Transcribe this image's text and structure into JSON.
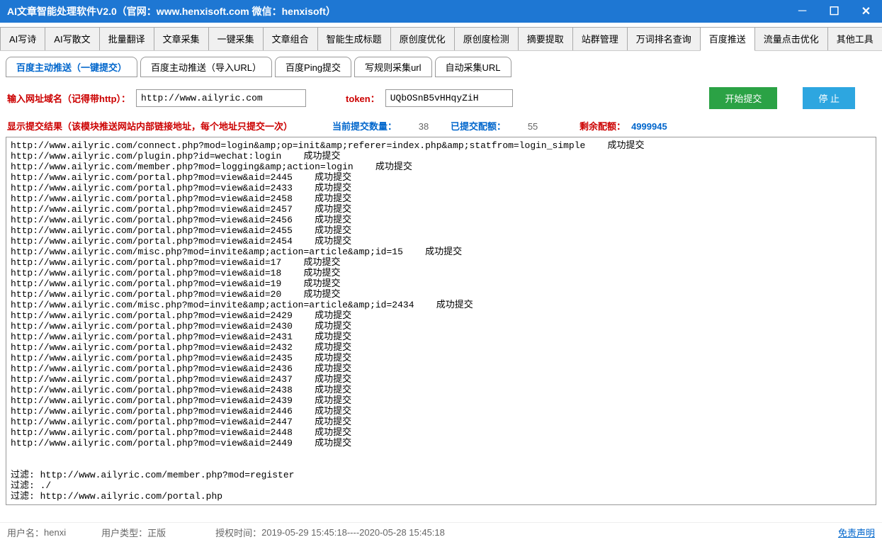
{
  "title": "AI文章智能处理软件V2.0（官网：www.henxisoft.com  微信：henxisoft）",
  "mainTabs": [
    "AI写诗",
    "AI写散文",
    "批量翻译",
    "文章采集",
    "一键采集",
    "文章组合",
    "智能生成标题",
    "原创度优化",
    "原创度检测",
    "摘要提取",
    "站群管理",
    "万词排名查询",
    "百度推送",
    "流量点击优化",
    "其他工具"
  ],
  "activeMainTab": 12,
  "subTabs": [
    "百度主动推送（一键提交）",
    "百度主动推送（导入URL）",
    "百度Ping提交",
    "写规则采集url",
    "自动采集URL"
  ],
  "activeSubTab": 0,
  "form": {
    "urlLabel": "输入网址域名（记得带http）：",
    "urlValue": "http://www.ailyric.com",
    "tokenLabel": "token：",
    "tokenValue": "UQbOSnB5vHHqyZiH",
    "startBtn": "开始提交",
    "stopBtn": "停  止"
  },
  "status": {
    "resultLabel": "显示提交结果（该模块推送网站内部链接地址，每个地址只提交一次）",
    "currentLabel": "当前提交数量：",
    "currentValue": "38",
    "submittedLabel": "已提交配额：",
    "submittedValue": "55",
    "remainLabel": "剩余配额：",
    "remainValue": "4999945"
  },
  "log": "http://www.ailyric.com/connect.php?mod=login&amp;op=init&amp;referer=index.php&amp;statfrom=login_simple    成功提交\nhttp://www.ailyric.com/plugin.php?id=wechat:login    成功提交\nhttp://www.ailyric.com/member.php?mod=logging&amp;action=login    成功提交\nhttp://www.ailyric.com/portal.php?mod=view&aid=2445    成功提交\nhttp://www.ailyric.com/portal.php?mod=view&aid=2433    成功提交\nhttp://www.ailyric.com/portal.php?mod=view&aid=2458    成功提交\nhttp://www.ailyric.com/portal.php?mod=view&aid=2457    成功提交\nhttp://www.ailyric.com/portal.php?mod=view&aid=2456    成功提交\nhttp://www.ailyric.com/portal.php?mod=view&aid=2455    成功提交\nhttp://www.ailyric.com/portal.php?mod=view&aid=2454    成功提交\nhttp://www.ailyric.com/misc.php?mod=invite&amp;action=article&amp;id=15    成功提交\nhttp://www.ailyric.com/portal.php?mod=view&aid=17    成功提交\nhttp://www.ailyric.com/portal.php?mod=view&aid=18    成功提交\nhttp://www.ailyric.com/portal.php?mod=view&aid=19    成功提交\nhttp://www.ailyric.com/portal.php?mod=view&aid=20    成功提交\nhttp://www.ailyric.com/misc.php?mod=invite&amp;action=article&amp;id=2434    成功提交\nhttp://www.ailyric.com/portal.php?mod=view&aid=2429    成功提交\nhttp://www.ailyric.com/portal.php?mod=view&aid=2430    成功提交\nhttp://www.ailyric.com/portal.php?mod=view&aid=2431    成功提交\nhttp://www.ailyric.com/portal.php?mod=view&aid=2432    成功提交\nhttp://www.ailyric.com/portal.php?mod=view&aid=2435    成功提交\nhttp://www.ailyric.com/portal.php?mod=view&aid=2436    成功提交\nhttp://www.ailyric.com/portal.php?mod=view&aid=2437    成功提交\nhttp://www.ailyric.com/portal.php?mod=view&aid=2438    成功提交\nhttp://www.ailyric.com/portal.php?mod=view&aid=2439    成功提交\nhttp://www.ailyric.com/portal.php?mod=view&aid=2446    成功提交\nhttp://www.ailyric.com/portal.php?mod=view&aid=2447    成功提交\nhttp://www.ailyric.com/portal.php?mod=view&aid=2448    成功提交\nhttp://www.ailyric.com/portal.php?mod=view&aid=2449    成功提交\n\n\n过滤: http://www.ailyric.com/member.php?mod=register\n过滤: ./\n过滤: http://www.ailyric.com/portal.php",
  "footer": {
    "userLabel": "用户名：",
    "userValue": "henxi",
    "typeLabel": "用户类型：",
    "typeValue": "正版",
    "authLabel": "授权时间：",
    "authValue": "2019-05-29 15:45:18----2020-05-28 15:45:18",
    "disclaimer": "免责声明"
  }
}
